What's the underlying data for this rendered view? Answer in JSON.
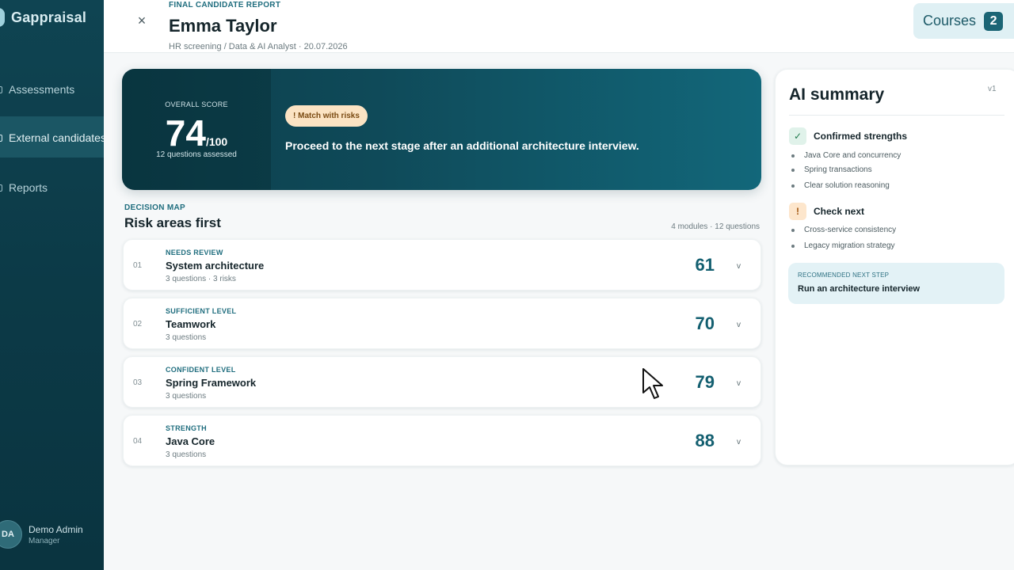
{
  "sidebar": {
    "brand": "Gappraisal",
    "items": [
      {
        "label": "Assessments"
      },
      {
        "label": "External candidates"
      },
      {
        "label": "Reports"
      }
    ],
    "user": {
      "initials": "DA",
      "name": "Demo Admin",
      "role": "Manager"
    }
  },
  "header": {
    "kicker": "FINAL CANDIDATE REPORT",
    "name": "Emma Taylor",
    "subtitle": "HR screening / Data & AI Analyst · 20.07.2026",
    "close_icon": "×",
    "courses_label": "Courses",
    "courses_count": "2"
  },
  "hero": {
    "score_kicker": "OVERALL SCORE",
    "score": "74",
    "score_max": "/100",
    "score_note": "12 questions assessed",
    "badge": "! Match with risks",
    "recommendation": "Proceed to the next stage after an additional architecture interview.",
    "progress_value": 74
  },
  "decision_map": {
    "kicker": "DECISION MAP",
    "title": "Risk areas first",
    "meta": "4 modules · 12 questions",
    "modules": [
      {
        "num": "01",
        "status": "NEEDS REVIEW",
        "name": "System architecture",
        "sub": "3 questions · 3 risks",
        "score": "61",
        "chevron": "v"
      },
      {
        "num": "02",
        "status": "SUFFICIENT LEVEL",
        "name": "Teamwork",
        "sub": "3 questions",
        "score": "70",
        "chevron": "v"
      },
      {
        "num": "03",
        "status": "CONFIDENT LEVEL",
        "name": "Spring Framework",
        "sub": "3 questions",
        "score": "79",
        "chevron": "v"
      },
      {
        "num": "04",
        "status": "STRENGTH",
        "name": "Java Core",
        "sub": "3 questions",
        "score": "88",
        "chevron": "v"
      }
    ]
  },
  "summary": {
    "title": "AI summary",
    "version": "v1",
    "strengths_icon": "✓",
    "strengths_label": "Confirmed strengths",
    "strengths": [
      "Java Core and concurrency",
      "Spring transactions",
      "Clear solution reasoning"
    ],
    "check_icon": "!",
    "check_label": "Check next",
    "check": [
      "Cross-service consistency",
      "Legacy migration strategy"
    ],
    "next_kicker": "RECOMMENDED NEXT STEP",
    "next_text": "Run an architecture interview"
  },
  "colors": {
    "sidebar_bg": "#0f4452",
    "accent": "#135f70",
    "badge_bg": "#fbe3c3",
    "courses_bg": "#dff0f4"
  }
}
